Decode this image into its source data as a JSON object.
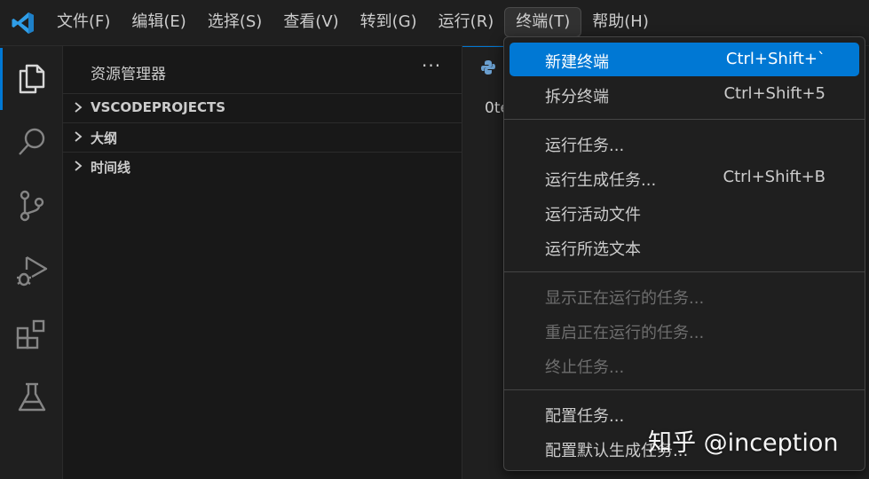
{
  "menubar": {
    "items": [
      {
        "label": "文件(F)"
      },
      {
        "label": "编辑(E)"
      },
      {
        "label": "选择(S)"
      },
      {
        "label": "查看(V)"
      },
      {
        "label": "转到(G)"
      },
      {
        "label": "运行(R)"
      },
      {
        "label": "终端(T)"
      },
      {
        "label": "帮助(H)"
      }
    ],
    "open_item": "终端(T)"
  },
  "activitybar": {
    "icons": [
      "explorer-icon",
      "search-icon",
      "source-control-icon",
      "run-debug-icon",
      "extensions-icon",
      "testing-icon"
    ],
    "active": "explorer-icon"
  },
  "sidebar": {
    "title": "资源管理器",
    "more": "···",
    "sections": [
      {
        "label": "VSCODEPROJECTS"
      },
      {
        "label": "大纲"
      },
      {
        "label": "时间线"
      }
    ]
  },
  "editor": {
    "tab_icon": "python-icon",
    "visible_text": "0te"
  },
  "terminal_menu": {
    "items": [
      {
        "label": "新建终端",
        "shortcut": "Ctrl+Shift+`",
        "state": "highlighted"
      },
      {
        "label": "拆分终端",
        "shortcut": "Ctrl+Shift+5",
        "state": "enabled"
      },
      {
        "label": "运行任务...",
        "shortcut": "",
        "state": "enabled"
      },
      {
        "label": "运行生成任务...",
        "shortcut": "Ctrl+Shift+B",
        "state": "enabled"
      },
      {
        "label": "运行活动文件",
        "shortcut": "",
        "state": "enabled"
      },
      {
        "label": "运行所选文本",
        "shortcut": "",
        "state": "enabled"
      },
      {
        "label": "显示正在运行的任务...",
        "shortcut": "",
        "state": "disabled"
      },
      {
        "label": "重启正在运行的任务...",
        "shortcut": "",
        "state": "disabled"
      },
      {
        "label": "终止任务...",
        "shortcut": "",
        "state": "disabled"
      },
      {
        "label": "配置任务...",
        "shortcut": "",
        "state": "enabled"
      },
      {
        "label": "配置默认生成任务...",
        "shortcut": "",
        "state": "enabled"
      }
    ]
  },
  "watermark": "知乎 @inception",
  "colors": {
    "accent": "#0078d4",
    "background": "#181818",
    "menu_background": "#1f1f1f",
    "text": "#cccccc",
    "disabled_text": "#6e6e6e"
  }
}
